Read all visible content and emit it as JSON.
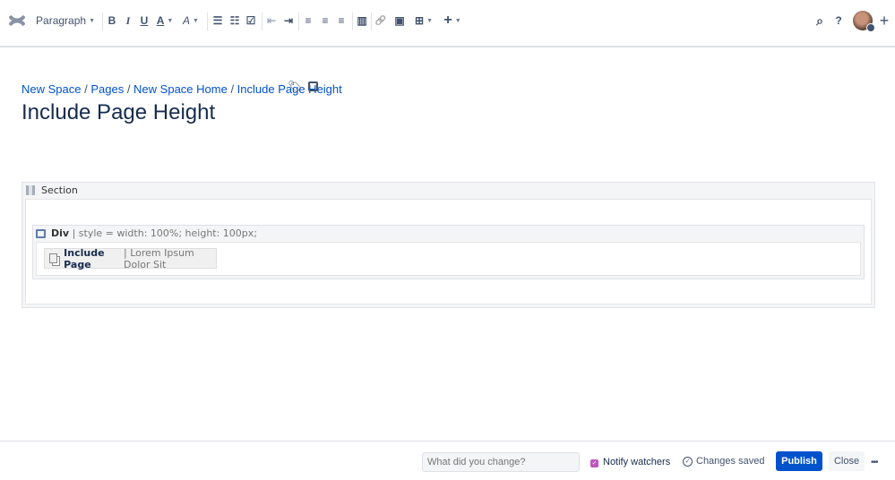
{
  "toolbar": {
    "paragraph": "Paragraph",
    "bold": "B",
    "italic": "I",
    "underline": "U",
    "text_color": "A",
    "styles": "A",
    "bullet": "☰",
    "numbered": "☷",
    "task": "☑",
    "outdent": "⇤",
    "indent": "⇥",
    "align_left": "≡",
    "align_center": "≡",
    "align_right": "≡",
    "layout": "▥",
    "link": "🔗",
    "image": "▣",
    "table": "⊞",
    "insert": "+",
    "search": "⌕",
    "help": "?",
    "create": "+"
  },
  "breadcrumb": [
    "New Space",
    "Pages",
    "New Space Home",
    "Include Page Height"
  ],
  "page_title": "Include Page Height",
  "section": {
    "label": "Section"
  },
  "div": {
    "label": "Div",
    "params": "| style = width: 100%; height: 100px;"
  },
  "include": {
    "label": "Include Page",
    "params": "| Lorem Ipsum Dolor Sit"
  },
  "footer": {
    "comment_placeholder": "What did you change?",
    "notify": "Notify watchers",
    "saved": "Changes saved",
    "publish": "Publish",
    "close": "Close",
    "more": "•••"
  },
  "colors": {
    "accent": "#0052cc",
    "checkbox": "#c054be"
  }
}
